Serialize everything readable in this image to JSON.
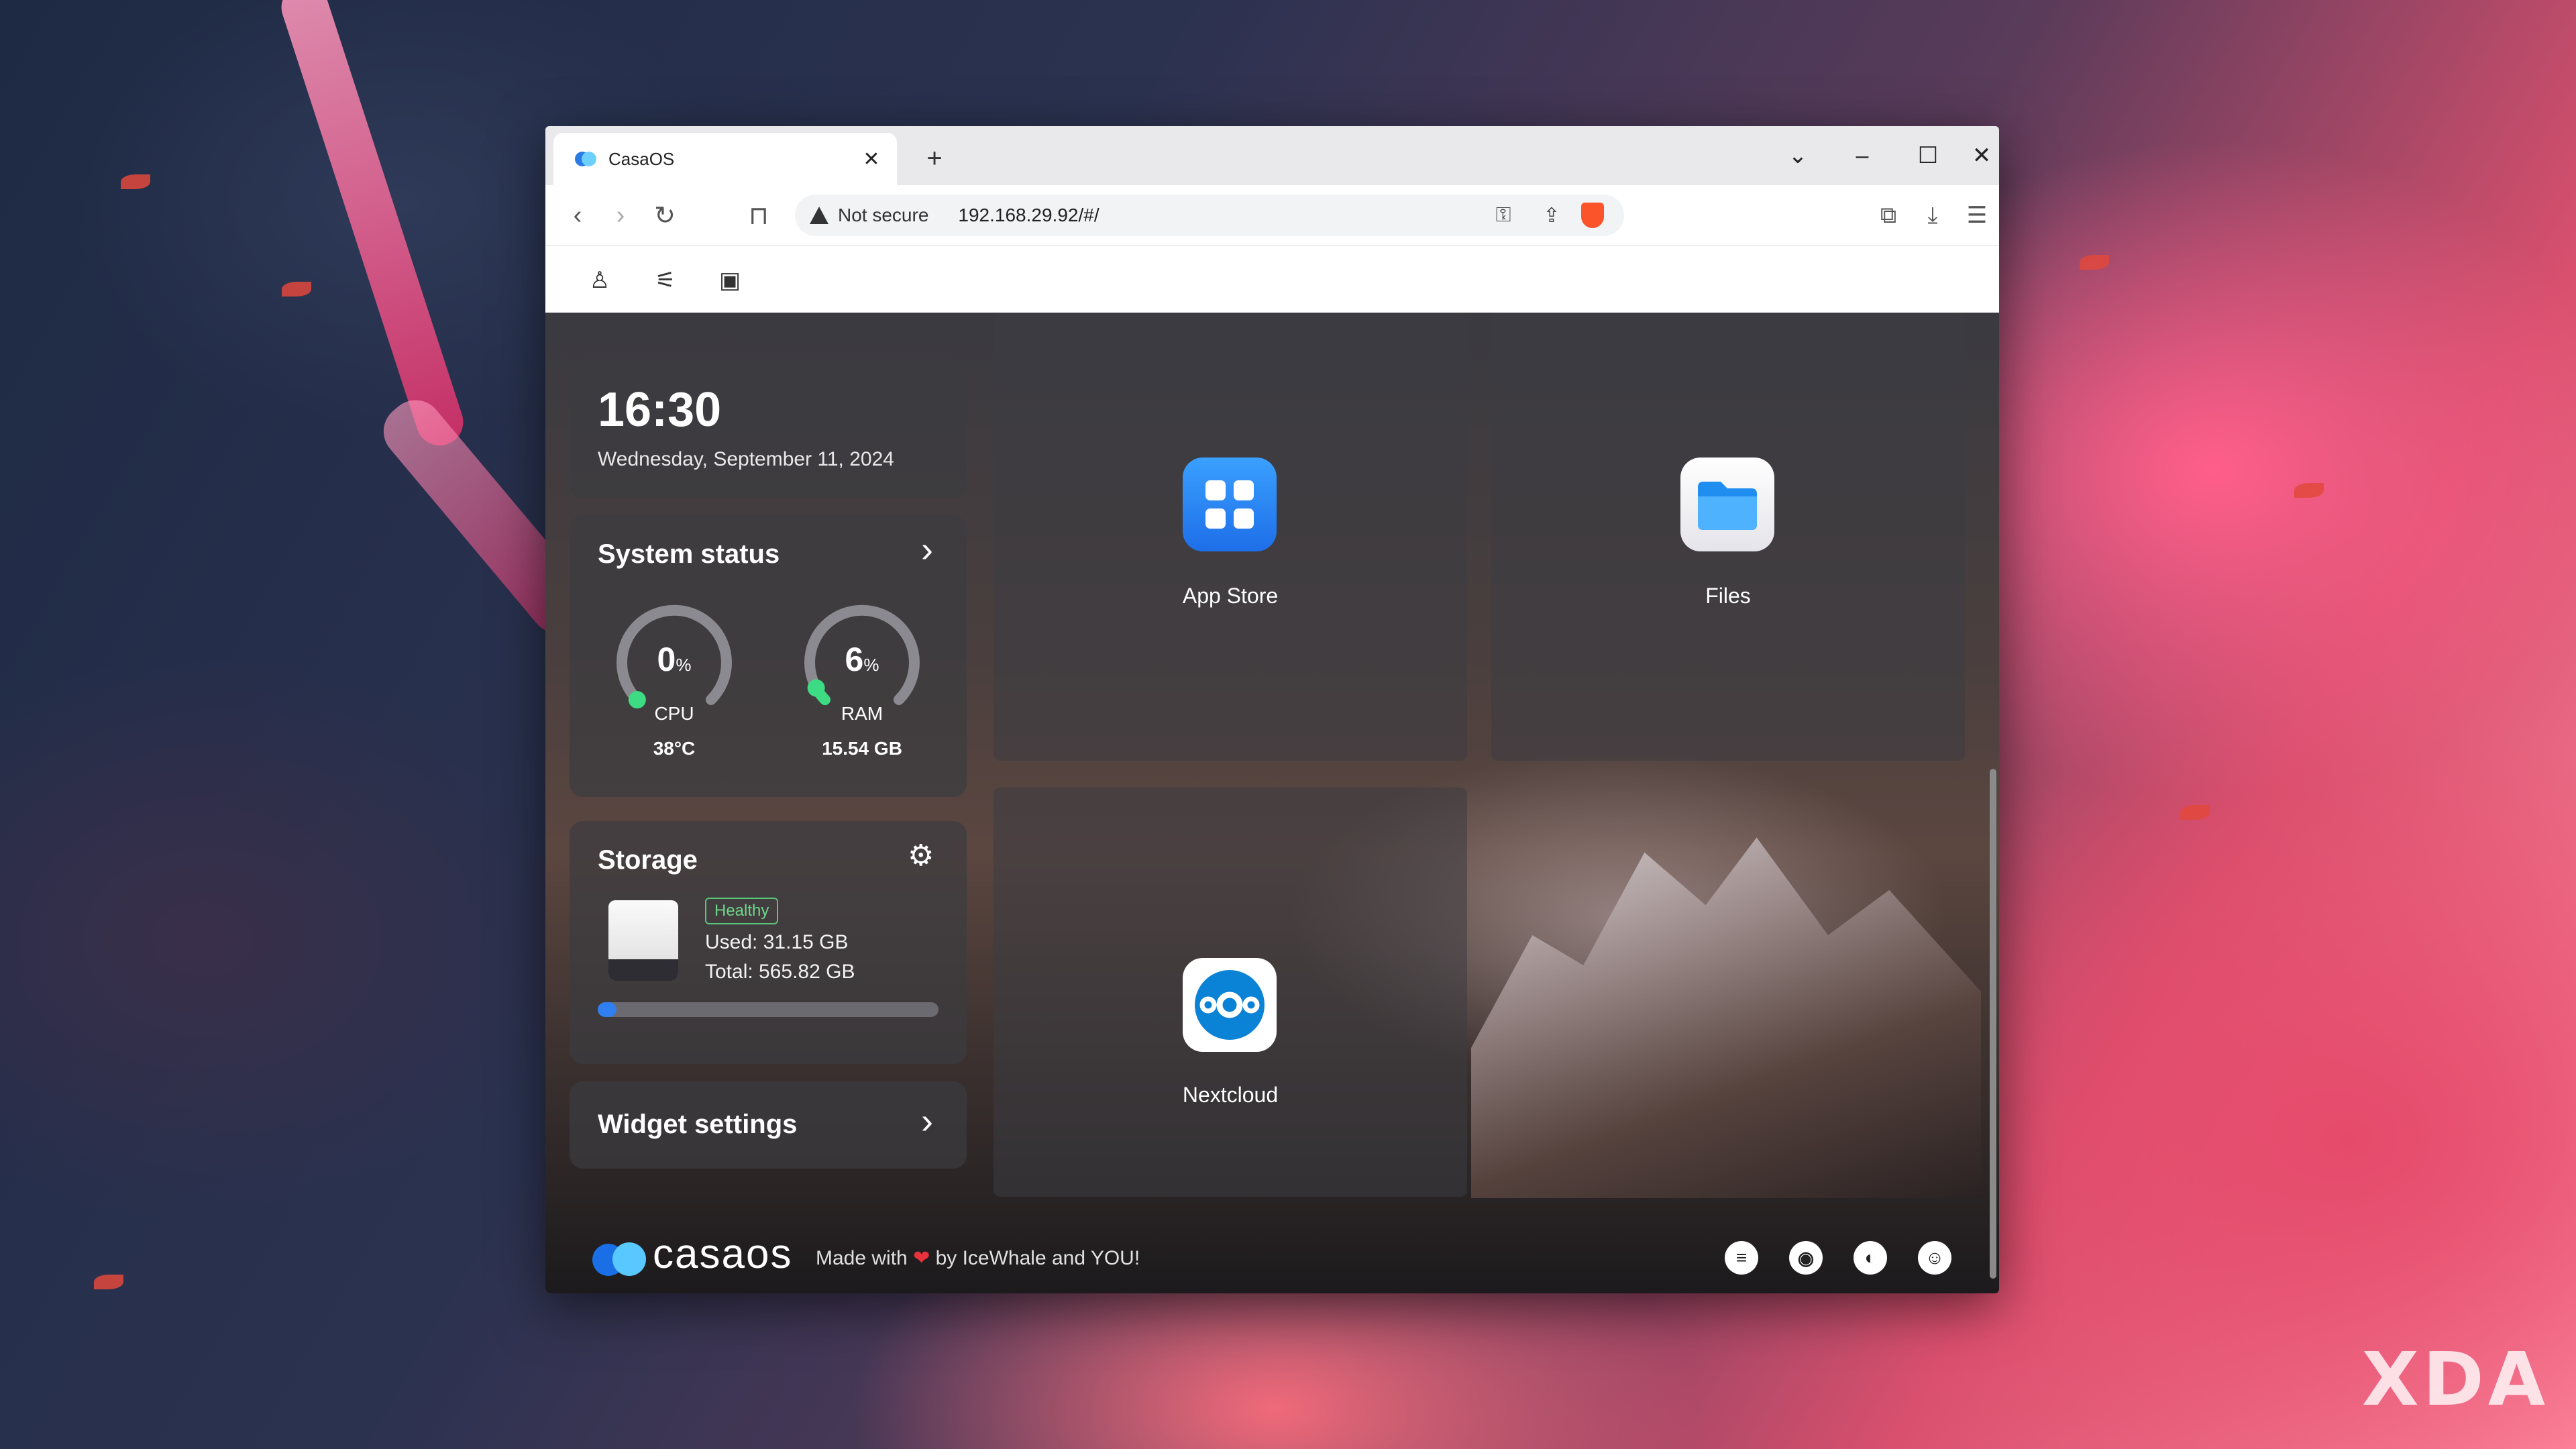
{
  "browser": {
    "tab_title": "CasaOS",
    "tab_close": "✕",
    "new_tab": "+",
    "minimize": "–",
    "maximize": "☐",
    "close": "✕",
    "tab_list": "⌄",
    "back": "‹",
    "forward": "›",
    "reload": "↻",
    "bookmark": "⊓",
    "security_label": "Not secure",
    "url": "192.168.29.92/#/",
    "key_icon": "⚿",
    "share_icon": "⇪",
    "extensions_icon": "⧉",
    "download_icon": "⤓",
    "menu_icon": "☰"
  },
  "casa_toolbar": {
    "user_icon": "♙",
    "settings_icon": "⚟",
    "screen_icon": "▣"
  },
  "clock": {
    "time": "16:30",
    "date": "Wednesday, September 11, 2024"
  },
  "system_status": {
    "title": "System status",
    "arrow": "›",
    "cpu": {
      "value": "0",
      "unit": "%",
      "label": "CPU",
      "sub": "38°C",
      "fraction": 0.0
    },
    "ram": {
      "value": "6",
      "unit": "%",
      "label": "RAM",
      "sub": "15.54 GB",
      "fraction": 0.06
    }
  },
  "storage": {
    "title": "Storage",
    "gear": "⚙",
    "status": "Healthy",
    "used": "Used: 31.15 GB",
    "total": "Total: 565.82 GB",
    "used_fraction": 0.055
  },
  "widget_settings": {
    "title": "Widget settings",
    "arrow": "›"
  },
  "apps": [
    {
      "name": "App Store",
      "icon": "app-store-icon"
    },
    {
      "name": "Files",
      "icon": "folder-icon"
    },
    {
      "name": "Nextcloud",
      "icon": "nextcloud-icon"
    }
  ],
  "footer": {
    "logo": "casaos",
    "made_with": "Made with",
    "by": "by IceWhale and YOU!",
    "heart": "❤"
  },
  "watermark": "XDA",
  "colors": {
    "accent": "#2f7ff0",
    "healthy": "#6ed68a",
    "gauge_green": "#3ddc84"
  }
}
